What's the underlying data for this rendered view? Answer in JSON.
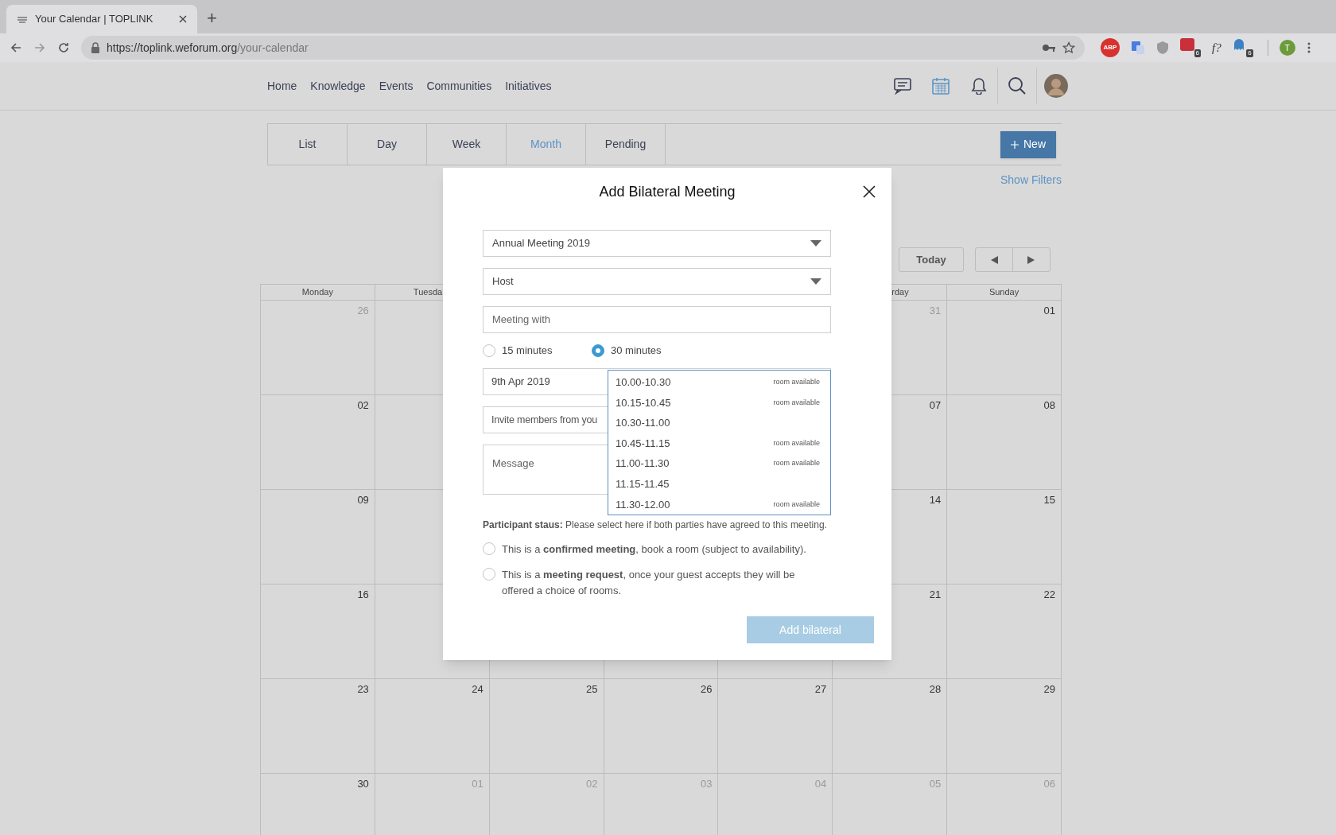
{
  "browser": {
    "tab_title": "Your Calendar | TOPLINK",
    "new_tab": "+",
    "url_host": "https://toplink.weforum.org",
    "url_path": "/your-calendar",
    "extensions": [
      {
        "kind": "abp",
        "label": "ABP"
      },
      {
        "kind": "translate"
      },
      {
        "kind": "shield"
      },
      {
        "kind": "dots",
        "badge": "6"
      },
      {
        "kind": "text",
        "label": "f?"
      },
      {
        "kind": "ghost",
        "badge": "6"
      }
    ],
    "profile": "T"
  },
  "nav": {
    "links": [
      "Home",
      "Knowledge",
      "Events",
      "Communities",
      "Initiatives"
    ],
    "icons": [
      {
        "kind": "chat",
        "selected": false
      },
      {
        "kind": "calendar",
        "selected": true
      },
      {
        "kind": "bell",
        "selected": false
      },
      {
        "kind": "search",
        "selected": false
      },
      {
        "kind": "avatar",
        "selected": false
      }
    ]
  },
  "views": [
    {
      "label": "List",
      "selected": false
    },
    {
      "label": "Day",
      "selected": false
    },
    {
      "label": "Week",
      "selected": false
    },
    {
      "label": "Month",
      "selected": true
    },
    {
      "label": "Pending",
      "selected": false
    }
  ],
  "new_button": "New",
  "show_filters": "Show Filters",
  "today_button": "Today",
  "calendar": {
    "headers": {
      "monday": "Monday",
      "tuesday": "Tuesda",
      "saturday": "rday",
      "sunday": "Sunday"
    },
    "weeks": [
      {
        "monday": {
          "day": "26",
          "muted": true
        },
        "saturday": {
          "day": "31",
          "muted": true
        },
        "sunday": {
          "day": "01",
          "muted": false
        }
      },
      {
        "monday": {
          "day": "02",
          "muted": false
        },
        "saturday": {
          "day": "07",
          "muted": false
        },
        "sunday": {
          "day": "08",
          "muted": false
        }
      },
      {
        "monday": {
          "day": "09",
          "muted": false
        },
        "saturday": {
          "day": "14",
          "muted": false
        },
        "sunday": {
          "day": "15",
          "muted": false
        }
      },
      {
        "monday": {
          "day": "16",
          "muted": false
        },
        "saturday": {
          "day": "21",
          "muted": false
        },
        "sunday": {
          "day": "22",
          "muted": false
        }
      },
      {
        "monday": {
          "day": "23",
          "muted": false
        },
        "tuesday": {
          "day": "24",
          "muted": false
        },
        "wednesday": {
          "day": "25",
          "muted": false
        },
        "thursday": {
          "day": "26",
          "muted": false
        },
        "friday": {
          "day": "27",
          "muted": false
        },
        "saturday": {
          "day": "28",
          "muted": false
        },
        "sunday": {
          "day": "29",
          "muted": false
        }
      },
      {
        "monday": {
          "day": "30",
          "muted": false
        },
        "tuesday": {
          "day": "01",
          "muted": true
        },
        "wednesday": {
          "day": "02",
          "muted": true
        },
        "thursday": {
          "day": "03",
          "muted": true
        },
        "friday": {
          "day": "04",
          "muted": true
        },
        "saturday": {
          "day": "05",
          "muted": true
        },
        "sunday": {
          "day": "06",
          "muted": true
        }
      }
    ]
  },
  "modal": {
    "title": "Add Bilateral Meeting",
    "fields": [
      {
        "kind": "select",
        "value": "Annual Meeting 2019"
      },
      {
        "kind": "select",
        "value": "Host"
      },
      {
        "kind": "text",
        "placeholder": "Meeting with"
      }
    ],
    "durations": [
      {
        "label": "15 minutes",
        "selected": false
      },
      {
        "label": "30 minutes",
        "selected": true
      }
    ],
    "date": "9th Apr 2019",
    "invite_placeholder": "Invite members from you",
    "message_placeholder": "Message",
    "time_slots": [
      {
        "time": "10.00-10.30",
        "note": "room available"
      },
      {
        "time": "10.15-10.45",
        "note": "room available"
      },
      {
        "time": "10.30-11.00"
      },
      {
        "time": "10.45-11.15",
        "note": "room available"
      },
      {
        "time": "11.00-11.30",
        "note": "room available"
      },
      {
        "time": "11.15-11.45"
      },
      {
        "time": "11.30-12.00",
        "note": "room available"
      }
    ],
    "participant_status": "**Participant staus:** Please select here if both parties have agreed to this meeting.",
    "options": [
      {
        "text": "This is a **confirmed meeting**, book a room (subject to availability).",
        "selected": false
      },
      {
        "text": "This is a **meeting request**, once your guest accepts they will be offered a choice of rooms.",
        "selected": false
      }
    ],
    "submit": {
      "label": "Add bilateral",
      "disabled": true
    }
  }
}
